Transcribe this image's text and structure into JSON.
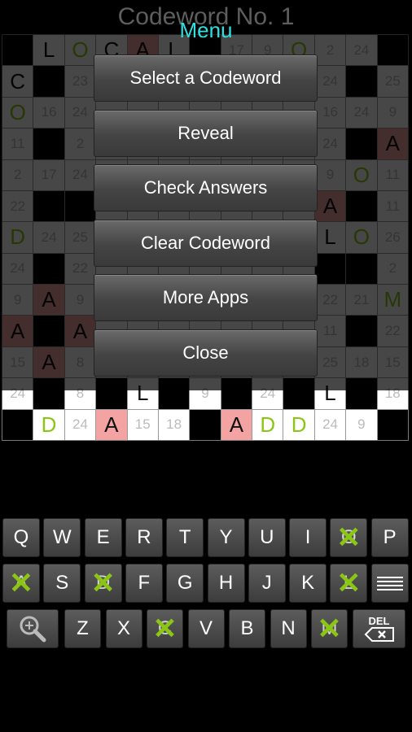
{
  "title": "Codeword No. 1",
  "highlight_letter": "A",
  "green_letters": [
    "O",
    "D",
    "M"
  ],
  "grid": [
    [
      "#",
      "L",
      "O",
      "C",
      "A",
      "L",
      "#",
      "17",
      "9",
      "O",
      "2",
      "24",
      "#"
    ],
    [
      "C",
      "#",
      "23",
      "",
      "",
      "",
      "",
      "",
      "",
      "",
      "24",
      "#",
      "25"
    ],
    [
      "O",
      "16",
      "24",
      "",
      "",
      "",
      "",
      "",
      "",
      "",
      "16",
      "24",
      "9"
    ],
    [
      "11",
      "#",
      "2",
      "",
      "",
      "",
      "",
      "",
      "",
      "",
      "24",
      "#",
      "A"
    ],
    [
      "2",
      "17",
      "24",
      "",
      "",
      "",
      "",
      "",
      "",
      "",
      "9",
      "O",
      "11"
    ],
    [
      "22",
      "#",
      "#",
      "",
      "",
      "",
      "",
      "",
      "",
      "",
      "A",
      "#",
      "11"
    ],
    [
      "D",
      "24",
      "25",
      "",
      "",
      "",
      "",
      "",
      "",
      "",
      "L",
      "O",
      "26"
    ],
    [
      "24",
      "#",
      "22",
      "",
      "",
      "",
      "",
      "",
      "",
      "",
      "#",
      "#",
      "2"
    ],
    [
      "9",
      "A",
      "9",
      "",
      "",
      "",
      "",
      "",
      "",
      "",
      "22",
      "21",
      "M"
    ],
    [
      "A",
      "#",
      "A",
      "",
      "",
      "",
      "",
      "",
      "",
      "",
      "11",
      "#",
      "22"
    ],
    [
      "15",
      "A",
      "8",
      "",
      "",
      "",
      "",
      "",
      "",
      "",
      "25",
      "18",
      "15"
    ],
    [
      "24",
      "#",
      "8",
      "#",
      "L",
      "#",
      "9",
      "#",
      "24",
      "#",
      "L",
      "#",
      "18"
    ],
    [
      "#",
      "D",
      "24",
      "A",
      "15",
      "18",
      "#",
      "A",
      "D",
      "D",
      "24",
      "9",
      "#"
    ]
  ],
  "menu": {
    "title": "Menu",
    "items": [
      "Select a Codeword",
      "Reveal",
      "Check Answers",
      "Clear Codeword",
      "More Apps",
      "Close"
    ]
  },
  "keyboard": {
    "row1": [
      "Q",
      "W",
      "E",
      "R",
      "T",
      "Y",
      "U",
      "I",
      "O",
      "P"
    ],
    "row2": [
      "A",
      "S",
      "D",
      "F",
      "G",
      "H",
      "J",
      "K",
      "L"
    ],
    "row3": [
      "Z",
      "X",
      "C",
      "V",
      "B",
      "N",
      "M"
    ],
    "used_letters": [
      "O",
      "A",
      "D",
      "L",
      "C",
      "M"
    ],
    "del_label": "DEL",
    "zoom_icon": "magnifier-plus-icon",
    "menu_icon": "hamburger-icon"
  }
}
